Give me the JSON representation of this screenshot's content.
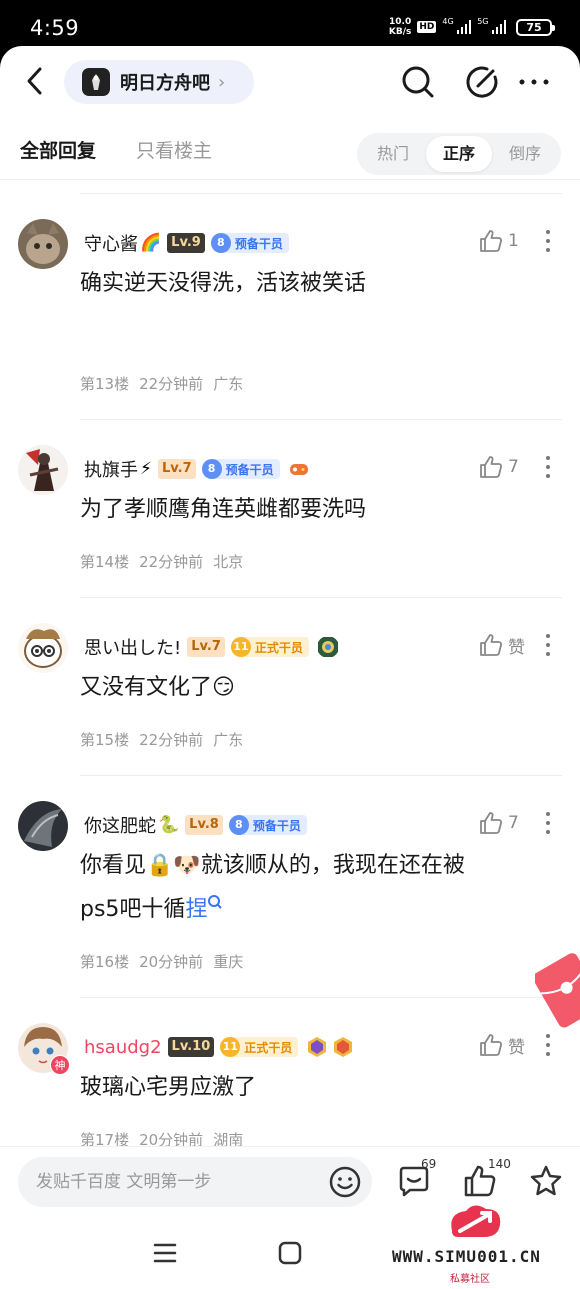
{
  "status_bar": {
    "time": "4:59",
    "speed_value": "10.0",
    "speed_unit": "KB/s",
    "hd_label": "HD",
    "net1": "4G",
    "net2": "5G",
    "battery": "75"
  },
  "nav": {
    "forum_name": "明日方舟吧",
    "chevron": "›"
  },
  "tabs": {
    "all": "全部回复",
    "owner_only": "只看楼主",
    "sort_options": [
      "热门",
      "正序",
      "倒序"
    ],
    "sort_selected": "正序"
  },
  "posts": [
    {
      "username": "守心酱",
      "name_emoji": "🌈",
      "level": "Lv.9",
      "tag_num": "8",
      "tag_label": "预备干员",
      "content": "确实逆天没得洗，活该被笑话",
      "floor": "第13楼",
      "time": "22分钟前",
      "location": "广东",
      "likes": "1"
    },
    {
      "username": "执旗手",
      "name_emoji": "⚡",
      "level": "Lv.7",
      "tag_num": "8",
      "tag_label": "预备干员",
      "content": "为了孝顺鹰角连英雌都要洗吗",
      "floor": "第14楼",
      "time": "22分钟前",
      "location": "北京",
      "likes": "7"
    },
    {
      "username": "思い出した!",
      "level": "Lv.7",
      "tag_num": "11",
      "tag_label": "正式干员",
      "content": "又没有文化了",
      "content_emoji": "😏",
      "floor": "第15楼",
      "time": "22分钟前",
      "location": "广东",
      "likes": "赞"
    },
    {
      "username": "你这肥蛇",
      "name_emoji": "🐍",
      "level": "Lv.8",
      "tag_num": "8",
      "tag_label": "预备干员",
      "content_line1_a": "你看见",
      "content_emoji1": "🔒",
      "content_emoji2": "🐶",
      "content_line1_b": "就该顺从的，我现在还在被",
      "content_line2": "ps5吧十循",
      "content_link": "捏",
      "floor": "第16楼",
      "time": "20分钟前",
      "location": "重庆",
      "likes": "7"
    },
    {
      "username": "hsaudg2",
      "level": "Lv.10",
      "tag_num": "11",
      "tag_label": "正式干员",
      "avatar_badge": "神",
      "content": "玻璃心宅男应激了",
      "floor": "第17楼",
      "time": "20分钟前",
      "location": "湖南",
      "likes": "赞"
    }
  ],
  "bottom": {
    "input_placeholder": "发贴千百度 文明第一步",
    "comment_count": "69",
    "like_count": "140"
  },
  "watermark": {
    "text": "WWW.SIMU001.CN",
    "sub": "私募社区"
  },
  "colors": {
    "accent_blue": "#3974f2",
    "gold": "#e48a00",
    "red_name": "#f0455f"
  }
}
